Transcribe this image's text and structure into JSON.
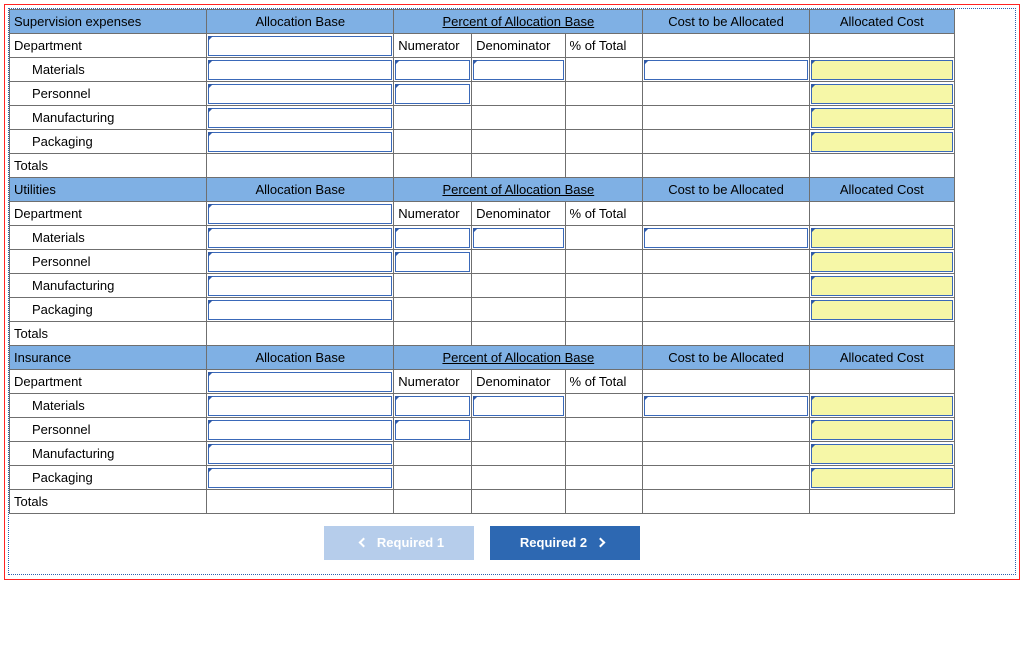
{
  "columns": {
    "allocation_base": "Allocation Base",
    "percent_base": "Percent of Allocation Base",
    "cost_alloc": "Cost to be Allocated",
    "alloc_cost": "Allocated Cost",
    "numerator": "Numerator",
    "denominator": "Denominator",
    "pct_total": "% of Total"
  },
  "row_labels": {
    "department": "Department",
    "materials": "Materials",
    "personnel": "Personnel",
    "manufacturing": "Manufacturing",
    "packaging": "Packaging",
    "totals": "Totals"
  },
  "sections": {
    "supervision": "Supervision expenses",
    "utilities": "Utilities",
    "insurance": "Insurance"
  },
  "nav": {
    "prev": "Required 1",
    "next": "Required 2"
  }
}
